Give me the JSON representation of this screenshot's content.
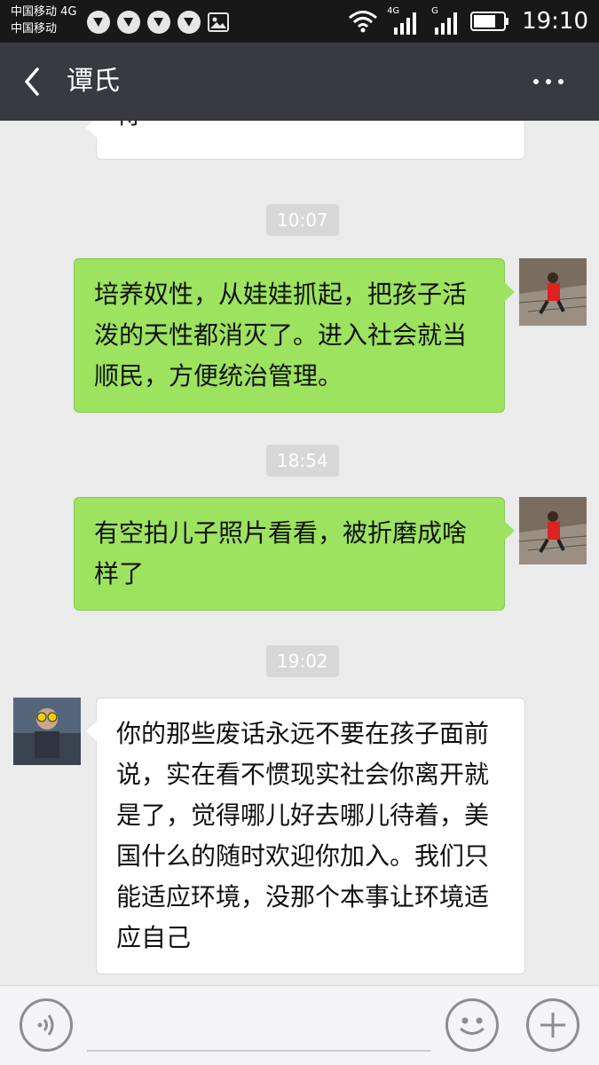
{
  "status_bar": {
    "carrier_line1": "中国移动 4G",
    "carrier_line2": "中国移动",
    "network_label_1": "4G",
    "network_label_2": "G",
    "time": "19:10"
  },
  "header": {
    "title": "谭氏"
  },
  "messages": [
    {
      "type": "received",
      "text": "待"
    },
    {
      "type": "time",
      "text": "10:07"
    },
    {
      "type": "sent",
      "lines": [
        "培养奴性，从娃娃抓起，把孩子活",
        "泼的天性都消灭了。进入社会就当",
        "顺民，方便统治管理。"
      ]
    },
    {
      "type": "time",
      "text": "18:54"
    },
    {
      "type": "sent",
      "lines": [
        "有空拍儿子照片看看，被折磨成啥",
        "样了"
      ]
    },
    {
      "type": "time",
      "text": "19:02"
    },
    {
      "type": "received",
      "lines": [
        "你的那些废话永远不要在孩子面前",
        "说，实在看不惯现实社会你离开就",
        "是了，觉得哪儿好去哪儿待着，美",
        "国什么的随时欢迎你加入。我们只",
        "能适应环境，没那个本事让环境适",
        "应自己"
      ]
    }
  ],
  "colors": {
    "sent_bubble": "#9de35f",
    "received_bubble": "#ffffff",
    "title_bar": "#393a3f",
    "chat_background": "#ebebeb"
  },
  "icons": {
    "back": "chevron-left-icon",
    "more": "more-dots-icon",
    "voice": "voice-icon",
    "emoji": "emoji-icon",
    "plus": "plus-icon"
  }
}
